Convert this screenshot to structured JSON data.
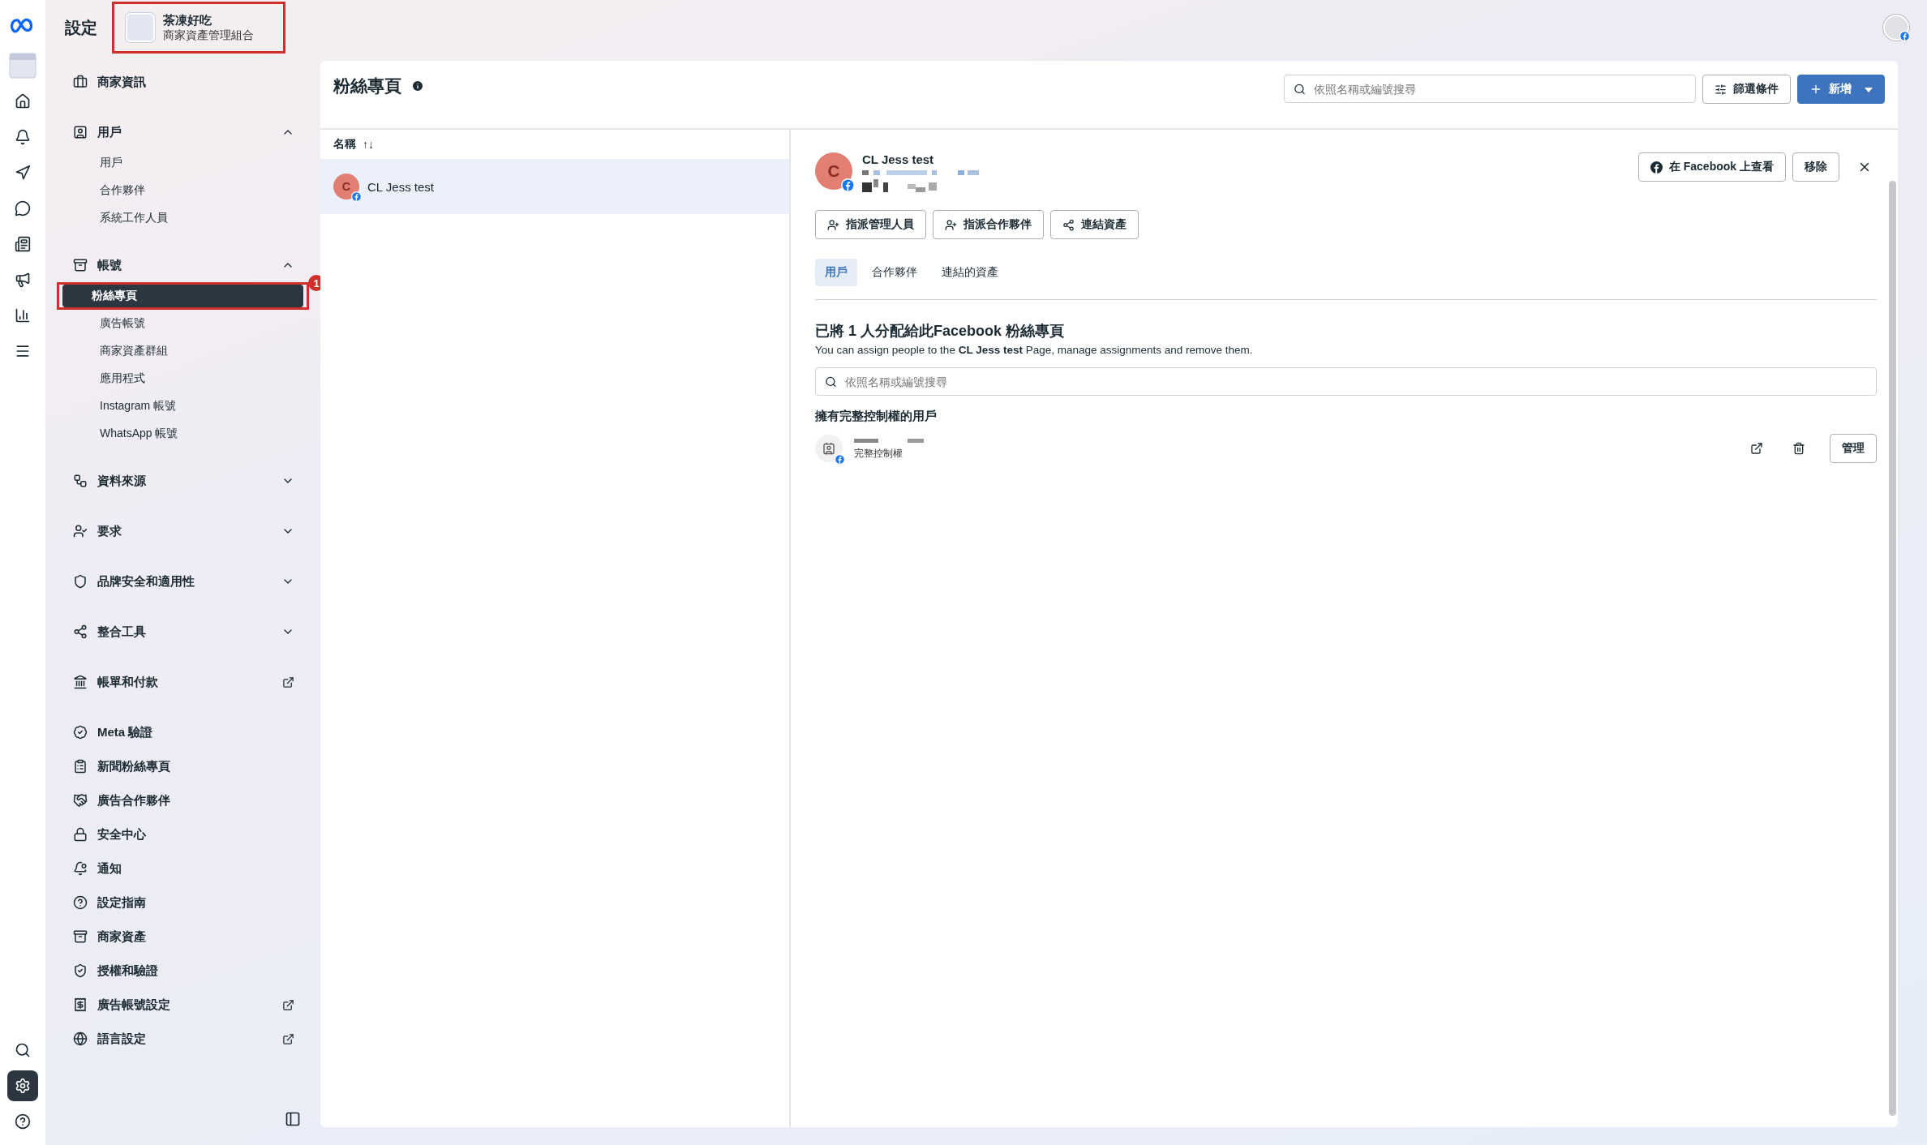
{
  "rail": {
    "top": [
      {
        "selected": false
      },
      {
        "selected": false
      },
      {
        "selected": false
      },
      {
        "selected": false
      },
      {
        "selected": false
      },
      {
        "selected": false
      },
      {
        "selected": false
      },
      {
        "selected": false
      },
      {
        "selected": false
      }
    ],
    "bottom": [
      {
        "selected": false
      },
      {
        "selected": true
      },
      {
        "selected": false
      }
    ]
  },
  "sidebar": {
    "title": "設定",
    "business": {
      "name": "茶凍好吃",
      "subtitle": "商家資產管理組合",
      "highlighted": true
    },
    "groups": [
      [
        {
          "kind": "link",
          "label": "商家資訊",
          "external": false
        }
      ],
      [
        {
          "kind": "expandable",
          "label": "用戶",
          "expanded": true,
          "children": [
            {
              "label": "用戶",
              "selected": false,
              "highlighted": false
            },
            {
              "label": "合作夥伴",
              "selected": false,
              "highlighted": false
            },
            {
              "label": "系統工作人員",
              "selected": false,
              "highlighted": false
            }
          ]
        }
      ],
      [
        {
          "kind": "expandable",
          "label": "帳號",
          "expanded": true,
          "children": [
            {
              "label": "粉絲專頁",
              "selected": true,
              "highlighted": true,
              "badge": "1"
            },
            {
              "label": "廣告帳號",
              "selected": false,
              "highlighted": false
            },
            {
              "label": "商家資產群組",
              "selected": false,
              "highlighted": false
            },
            {
              "label": "應用程式",
              "selected": false,
              "highlighted": false
            },
            {
              "label": "Instagram 帳號",
              "selected": false,
              "highlighted": false
            },
            {
              "label": "WhatsApp 帳號",
              "selected": false,
              "highlighted": false
            }
          ]
        }
      ],
      [
        {
          "kind": "expandable",
          "label": "資料來源",
          "expanded": false
        }
      ],
      [
        {
          "kind": "expandable",
          "label": "要求",
          "expanded": false
        }
      ],
      [
        {
          "kind": "expandable",
          "label": "品牌安全和適用性",
          "expanded": false
        }
      ],
      [
        {
          "kind": "expandable",
          "label": "整合工具",
          "expanded": false
        }
      ],
      [
        {
          "kind": "link",
          "label": "帳單和付款",
          "external": true
        }
      ],
      [
        {
          "kind": "link",
          "label": "Meta 驗證",
          "external": false
        },
        {
          "kind": "link",
          "label": "新聞粉絲專頁",
          "external": false
        },
        {
          "kind": "link",
          "label": "廣告合作夥伴",
          "external": false
        },
        {
          "kind": "link",
          "label": "安全中心",
          "external": false
        },
        {
          "kind": "link",
          "label": "通知",
          "external": false
        },
        {
          "kind": "link",
          "label": "設定指南",
          "external": false
        },
        {
          "kind": "link",
          "label": "商家資產",
          "external": false
        },
        {
          "kind": "link",
          "label": "授權和驗證",
          "external": false
        },
        {
          "kind": "link",
          "label": "廣告帳號設定",
          "external": true
        },
        {
          "kind": "link",
          "label": "語言設定",
          "external": true
        }
      ]
    ]
  },
  "main": {
    "title": "粉絲專頁",
    "search": {
      "placeholder": "依照名稱或編號搜尋"
    },
    "filter_button": "篩選條件",
    "add_button": "新增",
    "list": {
      "column": "名稱",
      "sort": "↑↓",
      "rows": [
        {
          "avatar": "C",
          "name": "CL Jess test",
          "selected": true
        }
      ]
    },
    "detail": {
      "avatar": "C",
      "name": "CL Jess test",
      "view_button": "在 Facebook 上查看",
      "remove_button": "移除",
      "actions": [
        "指派管理人員",
        "指派合作夥伴",
        "連結資產"
      ],
      "tabs": [
        {
          "label": "用戶",
          "selected": true
        },
        {
          "label": "合作夥伴",
          "selected": false
        },
        {
          "label": "連結的資產",
          "selected": false
        }
      ],
      "heading": "已將 1 人分配給此Facebook 粉絲專頁",
      "description": "You can assign people to the **CL Jess test** Page, manage assignments and remove them.",
      "search": {
        "placeholder": "依照名稱或編號搜尋"
      },
      "section_label": "擁有完整控制權的用戶",
      "users": [
        {
          "role": "完整控制權",
          "manage_button": "管理"
        }
      ]
    }
  }
}
